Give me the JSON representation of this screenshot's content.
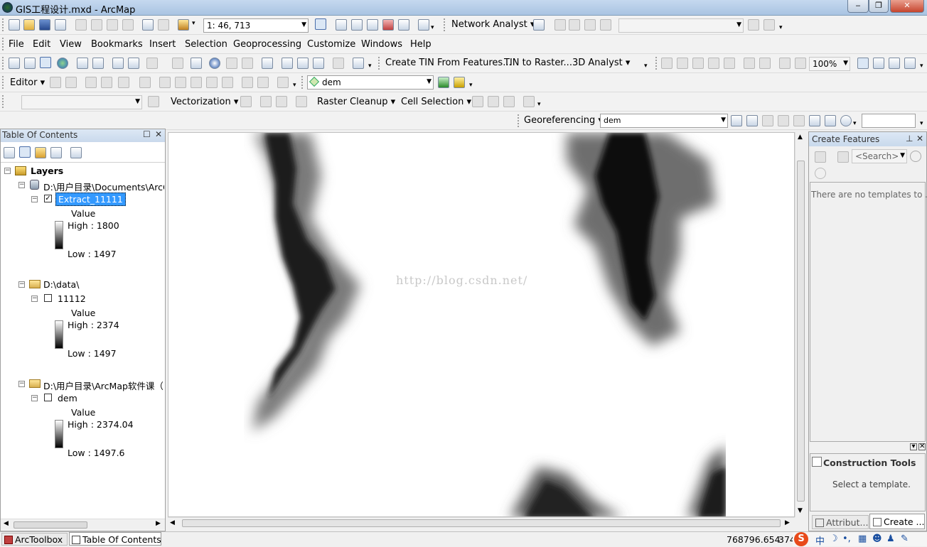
{
  "window": {
    "title": "GIS工程设计.mxd - ArcMap"
  },
  "standard_toolbar": {
    "scale": "1: 46, 713",
    "network_analyst": "Network Analyst"
  },
  "menu": [
    "File",
    "Edit",
    "View",
    "Bookmarks",
    "Insert",
    "Selection",
    "Geoprocessing",
    "Customize",
    "Windows",
    "Help"
  ],
  "tools_toolbar": {
    "create_tin": "Create TIN From Features...",
    "tin_to_raster": "TIN to Raster...",
    "analyst_3d": "3D Analyst",
    "zoom": "100%"
  },
  "editor_toolbar": {
    "editor": "Editor",
    "layer": "dem"
  },
  "vectorization_toolbar": {
    "vectorization": "Vectorization",
    "raster_cleanup": "Raster Cleanup",
    "cell_selection": "Cell Selection"
  },
  "georef_toolbar": {
    "label": "Georeferencing",
    "layer": "dem"
  },
  "toc": {
    "title": "Table Of Contents",
    "root": "Layers",
    "groups": [
      {
        "path": "D:\\用户目录\\Documents\\ArcG",
        "layer": "Extract_11111",
        "checked": true,
        "value_label": "Value",
        "high": "High : 1800",
        "low": "Low : 1497"
      },
      {
        "path": "D:\\data\\",
        "layer": "11112",
        "checked": false,
        "value_label": "Value",
        "high": "High : 2374",
        "low": "Low : 1497"
      },
      {
        "path": "D:\\用户目录\\ArcMap软件课（阝",
        "layer": "dem",
        "checked": false,
        "value_label": "Value",
        "high": "High : 2374.04",
        "low": "Low : 1497.6"
      }
    ]
  },
  "map": {
    "watermark": "http://blog.csdn.net/"
  },
  "create_features": {
    "title": "Create Features",
    "search_placeholder": "<Search>",
    "no_templates": "There are no templates to ...",
    "construction_tools": "Construction Tools",
    "select_template": "Select a template.",
    "tab_attributes": "Attribut...",
    "tab_create": "Create ..."
  },
  "bottom_tabs": {
    "arctoolbox": "ArcToolbox",
    "toc": "Table Of Contents"
  },
  "status": {
    "coords": "768796.654",
    "coords2": "374"
  },
  "colors": {
    "selection": "#3399ff",
    "titlebar": "#b8cfe9"
  }
}
